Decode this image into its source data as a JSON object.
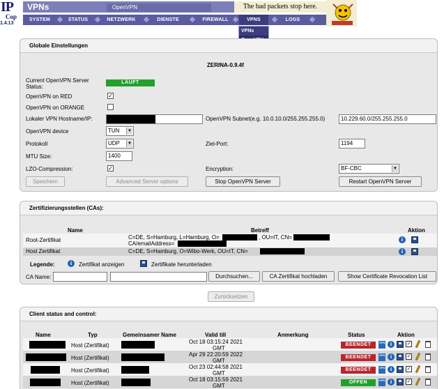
{
  "app": {
    "logo_top": "IP",
    "logo_bottom": "Cop",
    "version": "1.4.13",
    "title": "VPNs",
    "subtitle": "OpenVPN",
    "tagline": "The bad packets stop here."
  },
  "nav": {
    "items": [
      "SYSTEM",
      "STATUS",
      "NETZWERK",
      "DIENSTE",
      "FIREWALL",
      "VPNS",
      "LOGS"
    ],
    "dropdown": [
      "VPNs",
      "OpenVPN"
    ]
  },
  "global": {
    "heading": "Globale Einstellungen",
    "server_name": "ZERINA-0.9.4f",
    "status_label_1": "Current OpenVPN Server",
    "status_label_2": "Status:",
    "status_value": "LÄUFT",
    "on_red_label": "OpenVPN on RED",
    "on_orange_label": "OpenVPN on ORANGE",
    "hostname_label": "Lokaler VPN Hostname/IP:",
    "subnet_label": "OpenVPN Subnet(e.g. 10.0.10.0/255.255.255.0)",
    "subnet_value": "10.229.60.0/255.255.255.0",
    "device_label": "OpenVPN device",
    "device_value": "TUN",
    "protocol_label": "Protokoll",
    "protocol_value": "UDP",
    "port_label": "Ziel-Port:",
    "port_value": "1194",
    "mtu_label": "MTU Size:",
    "mtu_value": "1400",
    "lzo_label": "LZO-Compression:",
    "encryption_label": "Encryption:",
    "encryption_value": "BF-CBC",
    "btn_save": "Speichern",
    "btn_advanced": "Advanced Server options",
    "btn_stop": "Stop OpenVPN Server",
    "btn_restart": "Restart OpenVPN Server"
  },
  "cas": {
    "heading": "Zertifizierungsstellen (CAs):",
    "col_name": "Name",
    "col_subject": "Betreff",
    "col_action": "Aktion",
    "rows": [
      {
        "name": "Root-Zertifikat",
        "subject_line1_a": "C=DE, S=Hamburg, L=Hamburg, O=",
        "subject_line1_b": ", OU=IT, CN=",
        "subject_line2": "CA/emailAddress="
      },
      {
        "name": "Host Zertifikat",
        "subject_line1_a": "C=DE, S=Hamburg, O=Wibo-Werk, OU=IT, CN="
      }
    ],
    "legend_label": "Legende:",
    "legend_view": "Zertifikat anzeigen",
    "legend_download": "Zertifikate herunterladen",
    "ca_name_label": "CA Name:",
    "btn_browse": "Durchsuchen...",
    "btn_upload": "CA Zertifikat hochladen",
    "btn_crl": "Show Certificate Revocation List"
  },
  "reset_label": "Zurücksetzen",
  "clients": {
    "heading": "Client status and control:",
    "col_name": "Name",
    "col_type": "Typ",
    "col_common": "Gemeinsamer Name",
    "col_valid": "Valid till",
    "col_remark": "Anmerkung",
    "col_status": "Status",
    "col_action": "Aktion",
    "rows": [
      {
        "type": "Host (Zertifikat)",
        "valid_1": "Oct 18 03:15:24 2021",
        "valid_2": "GMT",
        "status": "BEENDET"
      },
      {
        "type": "Host (Zertifikat)",
        "valid_1": "Apr 29 22:20:59 2022",
        "valid_2": "GMT",
        "status": "BEENDET"
      },
      {
        "type": "Host (Zertifikat)",
        "valid_1": "Oct 23 02:44:58 2021",
        "valid_2": "GMT",
        "status": "BEENDET"
      },
      {
        "type": "Host (Zertifikat)",
        "valid_1": "Oct 18 03:15:59 2021",
        "valid_2": "GMT",
        "status": "OFFEN"
      }
    ]
  },
  "icon_labels": {
    "info": "i",
    "vpn": "VPN",
    "check": "✓",
    "dropdown_arrow": "▼"
  },
  "colors": {
    "nav_bg": "#5a5c9e",
    "status_green": "#21a12b",
    "status_red": "#b8262c"
  }
}
